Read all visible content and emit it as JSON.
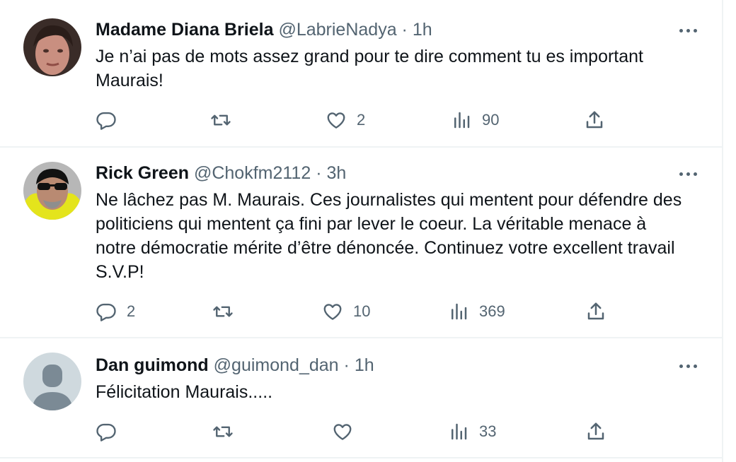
{
  "tweets": [
    {
      "name": "Madame Diana Briela",
      "handle": "@LabrieNadya",
      "separator": "·",
      "time": "1h",
      "text": "Je n’ai pas de mots assez grand pour te dire comment tu es important Maurais!",
      "replies": "",
      "retweets": "",
      "likes": "2",
      "views": "90",
      "avatar": "woman-photo-avatar"
    },
    {
      "name": "Rick Green",
      "handle": "@Chokfm2112",
      "separator": "·",
      "time": "3h",
      "text": "Ne lâchez pas M. Maurais. Ces journalistes qui mentent pour défendre des politiciens qui mentent ça fini par lever le coeur. La véritable menace à notre démocratie mérite d’être dénoncée. Continuez votre excellent travail S.V.P!",
      "replies": "2",
      "retweets": "",
      "likes": "10",
      "views": "369",
      "avatar": "man-sunglasses-avatar"
    },
    {
      "name": "Dan guimond",
      "handle": "@guimond_dan",
      "separator": "·",
      "time": "1h",
      "text": "Félicitation Maurais.....",
      "replies": "",
      "retweets": "",
      "likes": "",
      "views": "33",
      "avatar": "default-avatar"
    }
  ],
  "colors": {
    "text": "#0f1419",
    "secondary": "#536471",
    "divider": "#eff3f4",
    "default_avatar_bg": "#cfd9de",
    "default_avatar_fg": "#7b8a95"
  }
}
